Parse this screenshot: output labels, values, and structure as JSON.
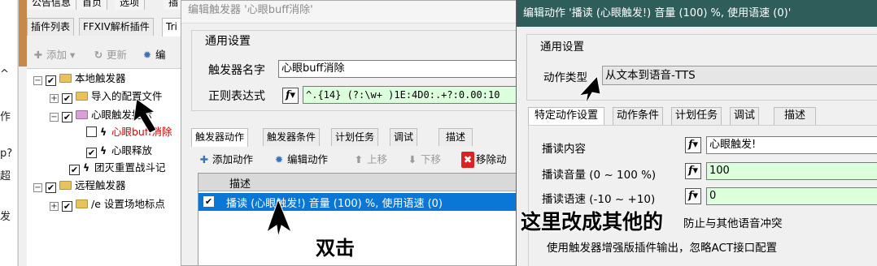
{
  "left_strip": {
    "lines": [
      "^",
      "作",
      "p?",
      "超",
      "发"
    ]
  },
  "plugin_window": {
    "top_menu": [
      "公告信息",
      "首页",
      "选项",
      "插"
    ],
    "tabs": [
      "插件列表",
      "FFXIV解析插件",
      "Tri"
    ],
    "toolbar": {
      "add": "添加",
      "refresh": "更新",
      "edit": "编"
    },
    "tree": [
      {
        "label": "本地触发器"
      },
      {
        "label": "导入的配置文件"
      },
      {
        "label": "心眼触发提示"
      },
      {
        "label": "心眼buff消除"
      },
      {
        "label": "心眼释放"
      },
      {
        "label": "团灭重置战斗记"
      },
      {
        "label": "远程触发器"
      },
      {
        "label": "/e 设置场地标点"
      }
    ]
  },
  "trigger_editor": {
    "title": "编辑触发器 '心眼buff消除'",
    "general_settings": "通用设置",
    "name_label": "触发器名字",
    "name_value": "心眼buff消除",
    "regex_label": "正则表达式",
    "regex_value": "^.{14} (?:\\w+ )1E:4D0:.+?:0.00:10",
    "tabs": [
      "触发器动作",
      "触发器条件",
      "计划任务",
      "调试",
      "描述"
    ],
    "toolbar": {
      "add_action": "添加动作",
      "edit_action": "编辑动作",
      "move_up": "上移",
      "move_down": "下移",
      "remove": "移除动"
    },
    "table_header": "描述",
    "table_row": "播读 (心眼触发!) 音量 (100) %, 使用语速 (0)"
  },
  "action_editor": {
    "title": "编辑动作 '播读 (心眼触发!) 音量 (100) %, 使用语速 (0)'",
    "general_settings": "通用设置",
    "action_type_label": "动作类型",
    "action_type_value": "从文本到语音-TTS",
    "tabs": [
      "特定动作设置",
      "动作条件",
      "计划任务",
      "调试",
      "描述"
    ],
    "content_label": "播读内容",
    "content_value": "心眼触发!",
    "volume_label": "播读音量 (0 ~ 100 %)",
    "volume_value": "100",
    "rate_label": "播读语速 (-10 ~ +10)",
    "rate_value": "0",
    "note1": "防止与其他语音冲突",
    "note2": "使用触发器增强版插件输出，忽略ACT接口配置"
  },
  "annotations": {
    "double_click": "双击",
    "change_here": "这里改成其他的"
  },
  "colors": {
    "selection": "#0a77d6",
    "title_bar": "#2f5e5a",
    "regex_bg": "#dcffdc",
    "red_text": "#e00000"
  }
}
